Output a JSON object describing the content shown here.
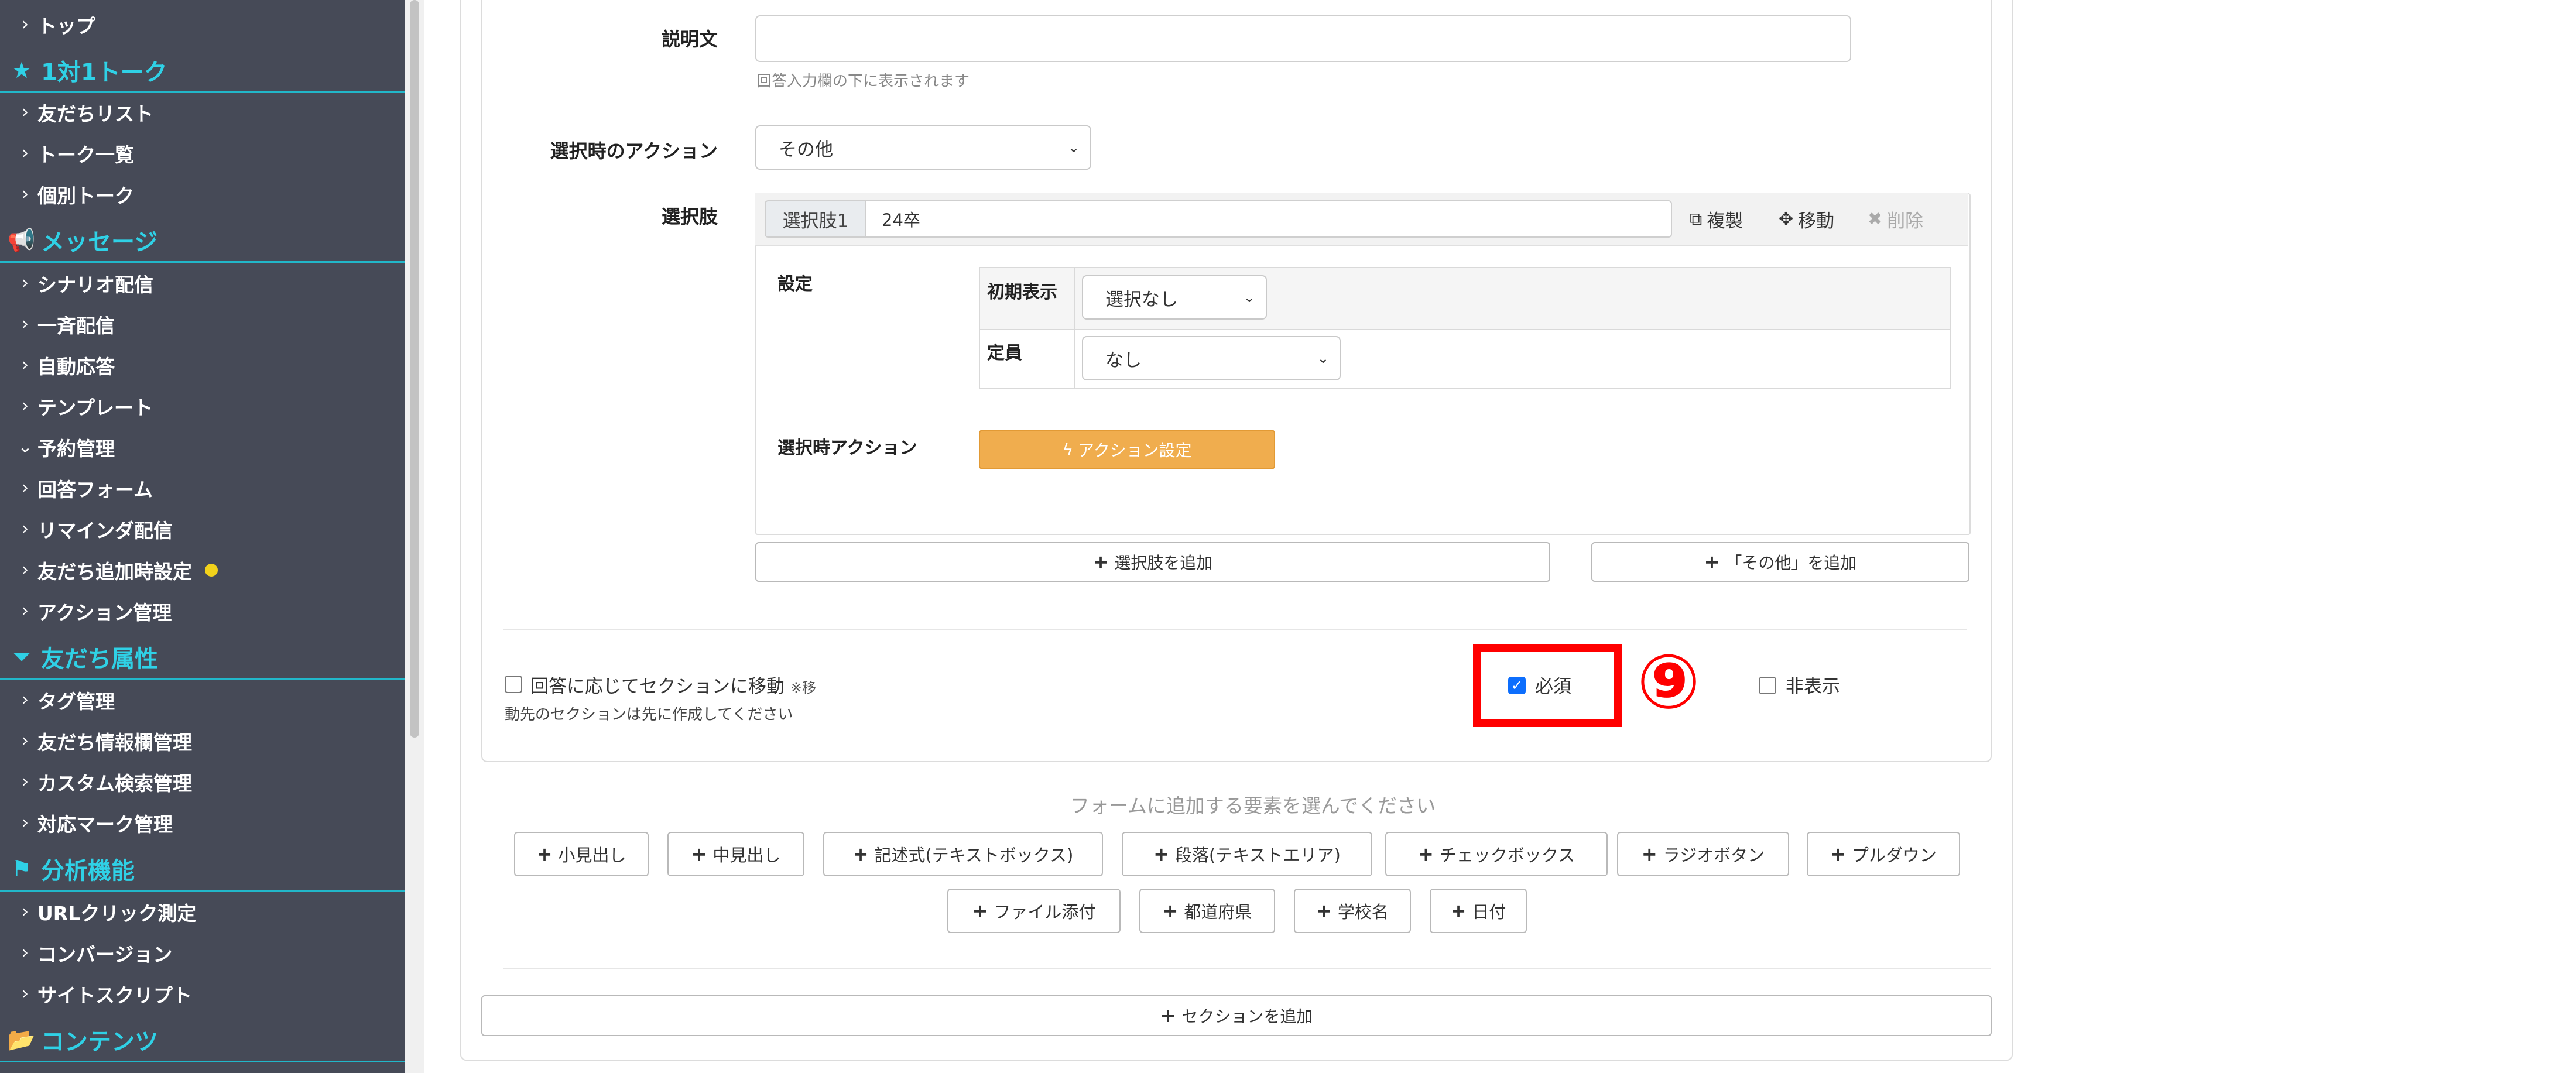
{
  "sidebar": {
    "items": [
      {
        "type": "item",
        "label": "トップ",
        "chevron": "›"
      },
      {
        "type": "header",
        "label": "1対1トーク",
        "icon": "star-icon",
        "glyph": "★"
      },
      {
        "type": "item",
        "label": "友だちリスト",
        "chevron": "›"
      },
      {
        "type": "item",
        "label": "トーク一覧",
        "chevron": "›"
      },
      {
        "type": "item",
        "label": "個別トーク",
        "chevron": "›"
      },
      {
        "type": "header",
        "label": "メッセージ",
        "icon": "megaphone-icon",
        "glyph": "📢"
      },
      {
        "type": "item",
        "label": "シナリオ配信",
        "chevron": "›"
      },
      {
        "type": "item",
        "label": "一斉配信",
        "chevron": "›"
      },
      {
        "type": "item",
        "label": "自動応答",
        "chevron": "›"
      },
      {
        "type": "item",
        "label": "テンプレート",
        "chevron": "›"
      },
      {
        "type": "item",
        "label": "予約管理",
        "chevron": "⌄"
      },
      {
        "type": "item",
        "label": "回答フォーム",
        "chevron": "›"
      },
      {
        "type": "item",
        "label": "リマインダ配信",
        "chevron": "›"
      },
      {
        "type": "item",
        "label": "友だち追加時設定",
        "chevron": "›",
        "dot": true
      },
      {
        "type": "item",
        "label": "アクション管理",
        "chevron": "›"
      },
      {
        "type": "header",
        "label": "友だち属性",
        "icon": "filter-icon",
        "glyph": "⏷"
      },
      {
        "type": "item",
        "label": "タグ管理",
        "chevron": "›"
      },
      {
        "type": "item",
        "label": "友だち情報欄管理",
        "chevron": "›"
      },
      {
        "type": "item",
        "label": "カスタム検索管理",
        "chevron": "›"
      },
      {
        "type": "item",
        "label": "対応マーク管理",
        "chevron": "›"
      },
      {
        "type": "header",
        "label": "分析機能",
        "icon": "flag-icon",
        "glyph": "⚑"
      },
      {
        "type": "item",
        "label": "URLクリック測定",
        "chevron": "›"
      },
      {
        "type": "item",
        "label": "コンバージョン",
        "chevron": "›"
      },
      {
        "type": "item",
        "label": "サイトスクリプト",
        "chevron": "›"
      },
      {
        "type": "header",
        "label": "コンテンツ",
        "icon": "folder-open-icon",
        "glyph": "📂"
      }
    ],
    "accent_color": "#2fd1e6",
    "background": "#464a57"
  },
  "form": {
    "description_label": "説明文",
    "description_value": "",
    "description_help": "回答入力欄の下に表示されます",
    "action_on_select_label": "選択時のアクション",
    "action_on_select_value": "その他",
    "choices_label": "選択肢",
    "choice": {
      "addon": "選択肢1",
      "value": "24卒",
      "copy_label": "複製",
      "move_label": "移動",
      "delete_label": "削除",
      "settings_label": "設定",
      "initial_display_label": "初期表示",
      "initial_display_value": "選択なし",
      "capacity_label": "定員",
      "capacity_value": "なし",
      "select_action_label": "選択時アクション",
      "action_button_label": "アクション設定"
    },
    "add_choice_label": "選択肢を追加",
    "add_other_label": "「その他」を追加",
    "jump_section_label": "回答に応じてセクションに移動",
    "jump_section_note": "※移",
    "jump_section_help": "動先のセクションは先に作成してください",
    "required_label": "必須",
    "required_checked": true,
    "hidden_label": "非表示",
    "hidden_checked": false,
    "step_marker": "⑨",
    "highlight_color": "#ff0000"
  },
  "add_elements": {
    "prompt": "フォームに追加する要素を選んでください",
    "row1": [
      "小見出し",
      "中見出し",
      "記述式(テキストボックス)",
      "段落(テキストエリア)",
      "チェックボックス",
      "ラジオボタン",
      "プルダウン"
    ],
    "row2": [
      "ファイル添付",
      "都道府県",
      "学校名",
      "日付"
    ]
  },
  "add_section_label": "セクションを追加"
}
